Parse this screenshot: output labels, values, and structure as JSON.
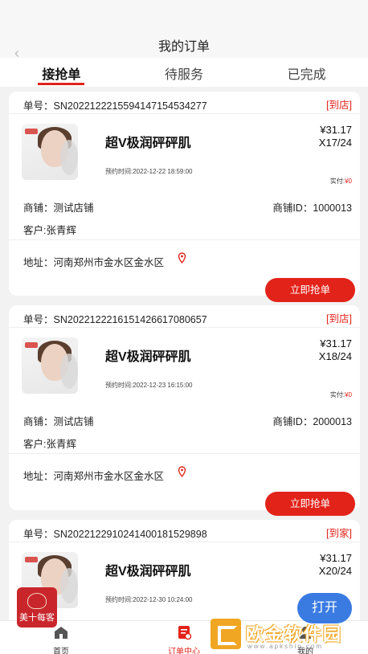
{
  "header": {
    "title": "我的订单"
  },
  "tabs": [
    {
      "label": "接抢单",
      "active": true
    },
    {
      "label": "待服务",
      "active": false
    },
    {
      "label": "已完成",
      "active": false
    }
  ],
  "orders": [
    {
      "order_no": "单号：SN20221222155941471545342​77",
      "tag": "[到店]",
      "product": "超V极润砰砰肌",
      "price": "¥31.17",
      "qty": "X17/24",
      "appt": "预约时间:2022-12-22 18:59:00",
      "paid_label": "实付:",
      "paid_value": "¥0",
      "shop": "商铺：测试店铺",
      "shop_id": "商铺ID：1000013",
      "customer": "客户:张青辉",
      "address": "地址：河南郑州市金水区金水区",
      "button": "立即抢单"
    },
    {
      "order_no": "单号：SN20221222161514266170806​57",
      "tag": "[到店]",
      "product": "超V极润砰砰肌",
      "price": "¥31.17",
      "qty": "X18/24",
      "appt": "预约时间:2022-12-23 16:15:00",
      "paid_label": "实付:",
      "paid_value": "¥0",
      "shop": "商铺：测试店铺",
      "shop_id": "商铺ID：2000013",
      "customer": "客户:张青辉",
      "address": "地址：河南郑州市金水区金水区",
      "button": "立即抢单"
    },
    {
      "order_no": "单号：SN20221229102414001815298​98",
      "tag": "[到家]",
      "product": "超V极润砰砰肌",
      "price": "¥31.17",
      "qty": "X20/24",
      "appt": "预约时间:2022-12-30 10:24:00"
    }
  ],
  "tabbar": [
    {
      "label": "首页",
      "icon": "home-icon"
    },
    {
      "label": "订单中心",
      "icon": "order-center-icon"
    },
    {
      "label": "我的",
      "icon": "profile-icon"
    }
  ],
  "float_logo": {
    "name": "美十每客"
  },
  "open_button": "打开",
  "watermark": {
    "text": "欧金软件园",
    "url": "www.apkshin.com"
  },
  "colors": {
    "accent": "#e2231a",
    "open_button": "#3a7be2",
    "watermark": "#f0a623"
  }
}
